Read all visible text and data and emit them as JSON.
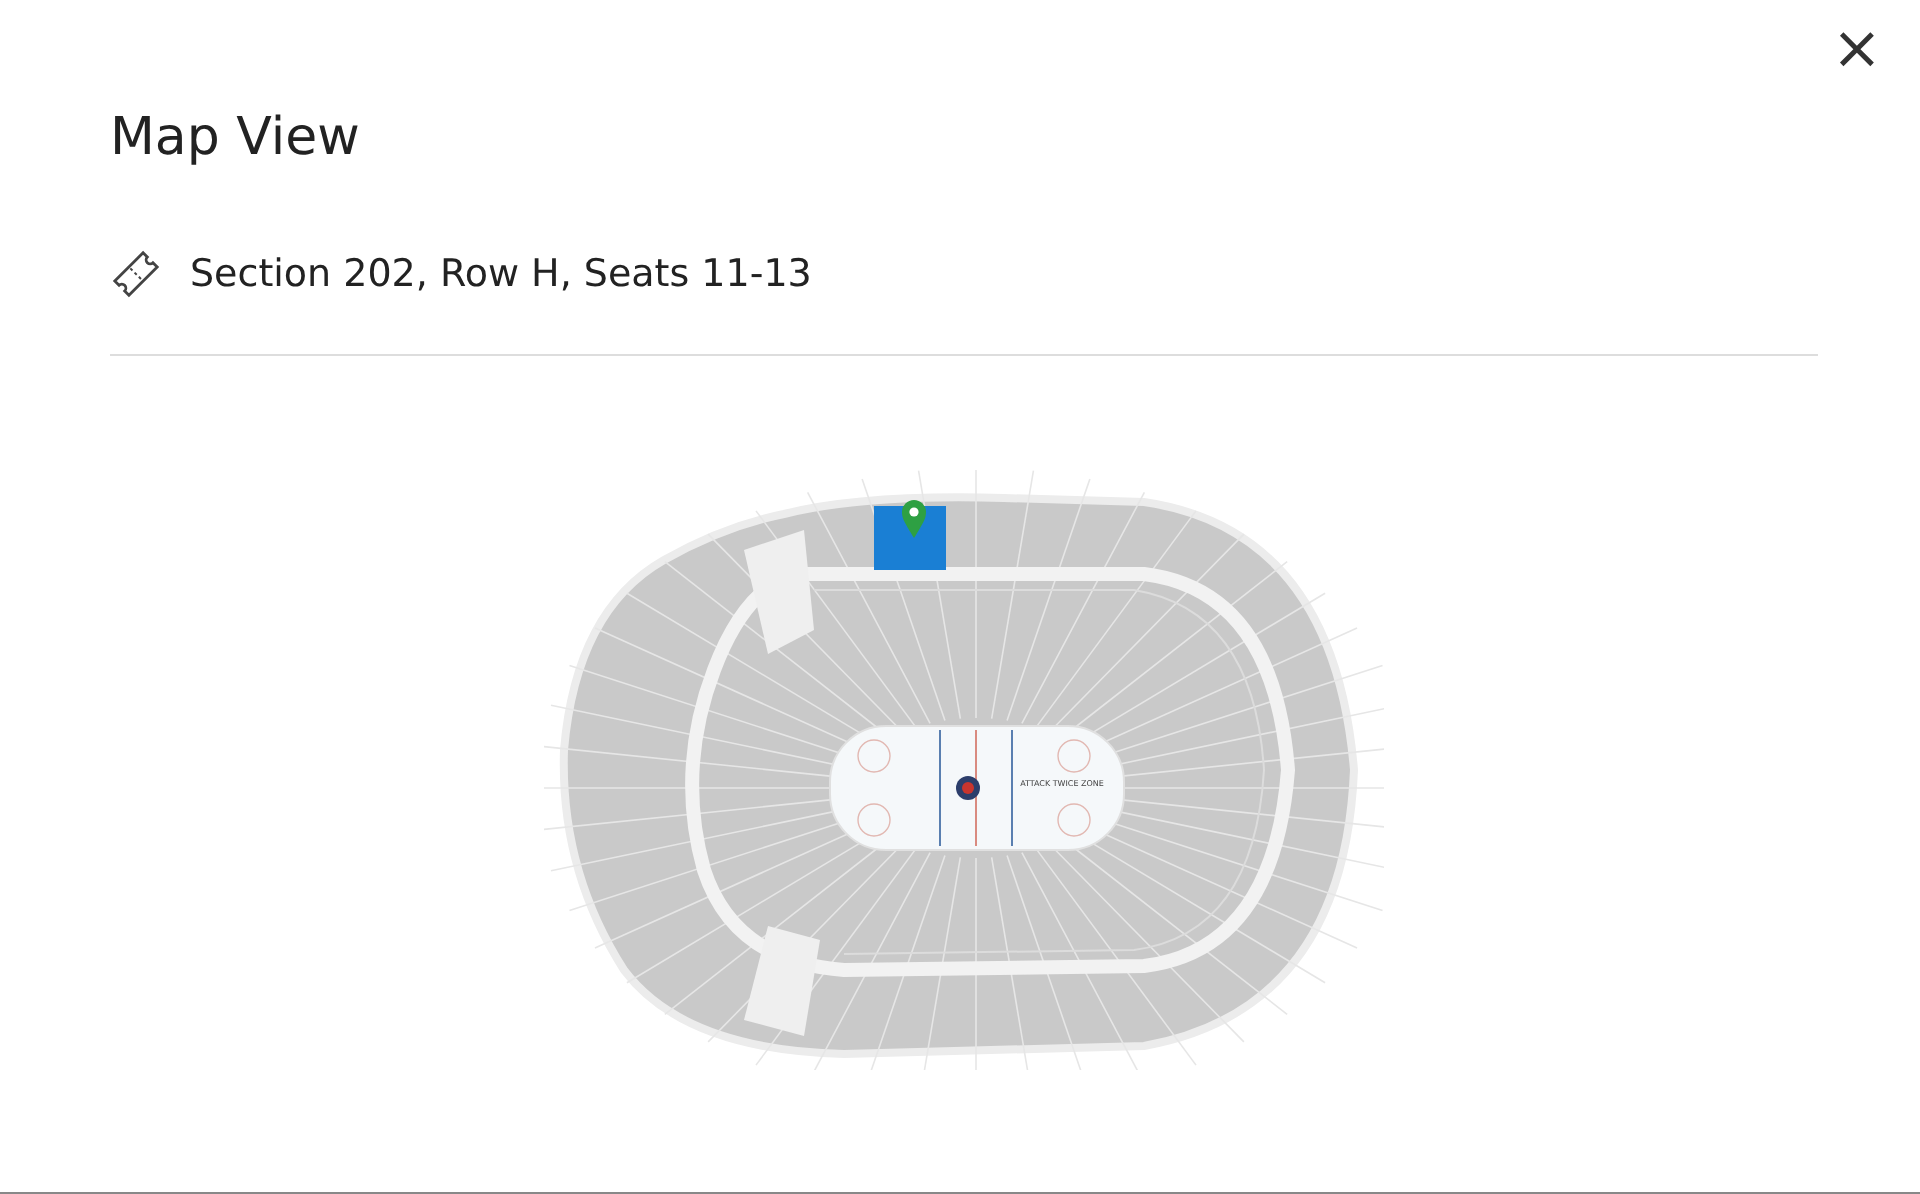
{
  "close_button": "×",
  "title": "Map View",
  "ticket": {
    "text": "Section 202, Row H, Seats 11-13"
  },
  "map": {
    "rink_label": "ATTACK TWICE ZONE"
  }
}
